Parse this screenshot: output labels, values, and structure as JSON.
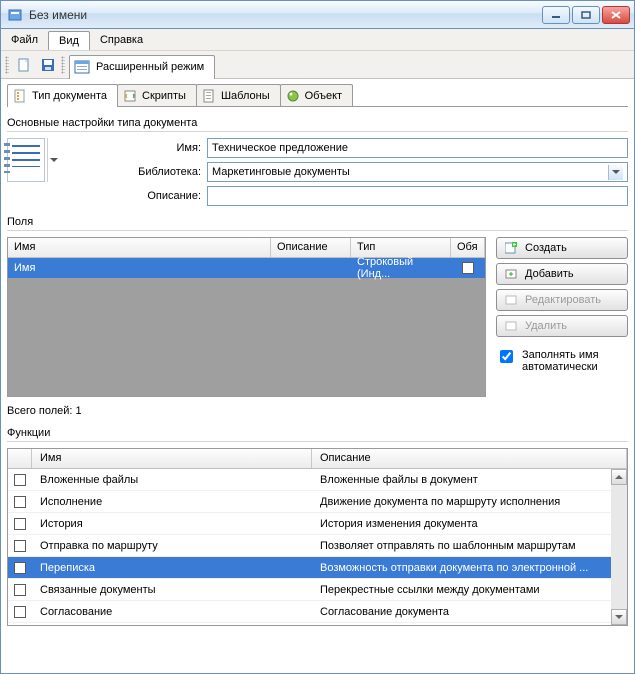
{
  "window": {
    "title": "Без имени"
  },
  "menu": {
    "file": "Файл",
    "view": "Вид",
    "help": "Справка"
  },
  "toolbar": {
    "extended_mode": "Расширенный режим"
  },
  "tabs": {
    "doc_type": "Тип документа",
    "scripts": "Скрипты",
    "templates": "Шаблоны",
    "object": "Объект"
  },
  "section": {
    "main_settings": "Основные настройки типа документа",
    "fields": "Поля",
    "functions": "Функции"
  },
  "form": {
    "name_label": "Имя:",
    "name_value": "Техническое предложение",
    "library_label": "Библиотека:",
    "library_value": "Маркетинговые документы",
    "description_label": "Описание:",
    "description_value": ""
  },
  "fields_grid": {
    "headers": {
      "name": "Имя",
      "desc": "Описание",
      "type": "Тип",
      "req": "Обя"
    },
    "rows": [
      {
        "name": "Имя",
        "desc": "",
        "type": "Строковый (Инд...",
        "req": false
      }
    ]
  },
  "buttons": {
    "create": "Создать",
    "add": "Добавить",
    "edit": "Редактировать",
    "delete": "Удалить",
    "autofill": "Заполнять имя автоматически"
  },
  "counter": "Всего полей: 1",
  "funcs": {
    "headers": {
      "name": "Имя",
      "desc": "Описание"
    },
    "rows": [
      {
        "name": "Вложенные файлы",
        "desc": "Вложенные файлы в документ",
        "sel": false
      },
      {
        "name": "Исполнение",
        "desc": "Движение документа по маршруту исполнения",
        "sel": false
      },
      {
        "name": "История",
        "desc": "История изменения документа",
        "sel": false
      },
      {
        "name": "Отправка по маршруту",
        "desc": "Позволяет отправлять по шаблонным маршрутам",
        "sel": false
      },
      {
        "name": "Переписка",
        "desc": "Возможность отправки документа по электронной ...",
        "sel": true
      },
      {
        "name": "Связанные документы",
        "desc": "Перекрестные ссылки между документами",
        "sel": false
      },
      {
        "name": "Согласование",
        "desc": "Согласование документа",
        "sel": false
      }
    ]
  }
}
